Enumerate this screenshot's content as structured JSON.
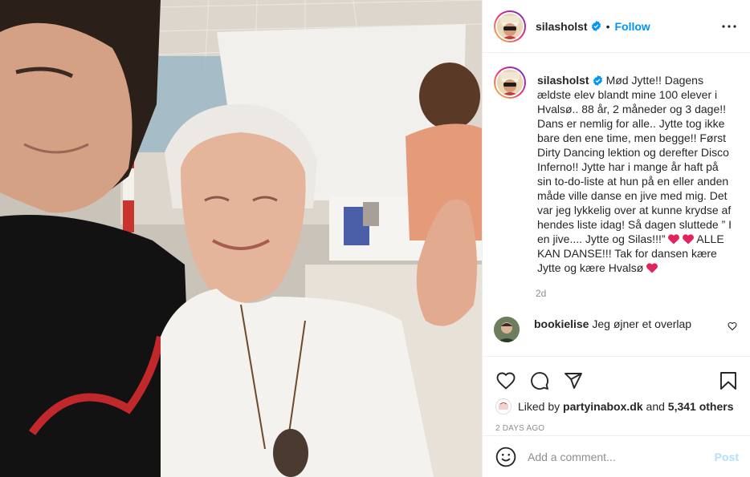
{
  "account": {
    "username": "silasholst",
    "follow_label": "Follow",
    "separator": "•"
  },
  "caption": {
    "username": "silasholst",
    "text_part1": "Mød Jytte!! Dagens ældste elev blandt mine 100 elever i Hvalsø.. 88 år, 2 måneder og 3 dage!! Dans er nemlig for alle.. Jytte tog ikke bare den ene time, men begge!! Først Dirty Dancing lektion og derefter Disco Inferno!! Jytte har i mange år haft på sin to-do-liste at hun på en eller anden måde ville danse en jive med mig. Det var jeg lykkelig over at kunne krydse af hendes liste idag! Så dagen sluttede ” I en jive.... Jytte og Silas!!!”",
    "text_part2": " ALLE KAN DANSE!!! Tak for dansen kære Jytte og kære Hvalsø",
    "time": "2d"
  },
  "comment": {
    "username": "bookielise",
    "text": "Jeg øjner et overlap"
  },
  "likes": {
    "prefix": "Liked by",
    "user": "partyinabox.dk",
    "conj": "and",
    "count": "5,341 others"
  },
  "posted": "2 DAYS AGO",
  "add_comment": {
    "placeholder": "Add a comment...",
    "post_label": "Post"
  },
  "colors": {
    "accent": "#0095f6",
    "post_disabled": "#b2dffc",
    "heart": "#e0245e",
    "muted": "#8e8e8e"
  },
  "icons": [
    "more-icon",
    "verified-icon",
    "like-icon",
    "comment-icon",
    "share-icon",
    "save-icon",
    "emoji-icon"
  ]
}
